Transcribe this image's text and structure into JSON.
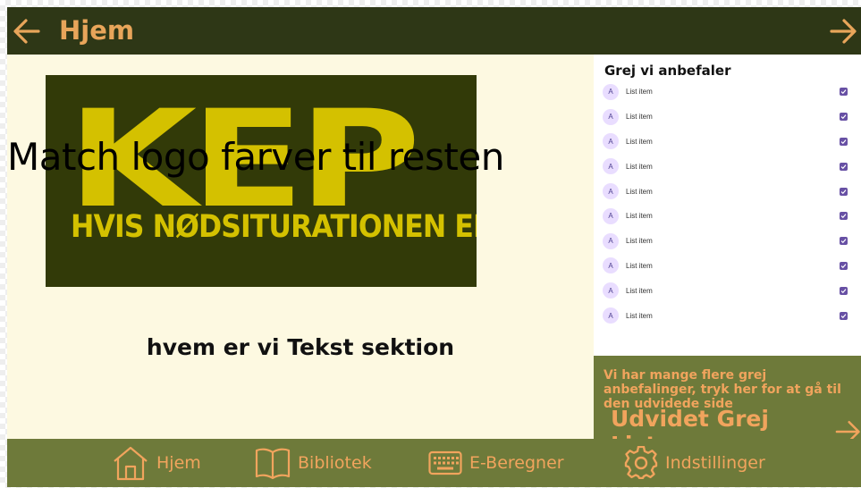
{
  "header": {
    "title": "Hjem"
  },
  "logo": {
    "big_text": "KEP",
    "tagline": "HVIS NØDSITURATIONEN ER."
  },
  "overlay_note": "Match logo farver til resten",
  "about_section": "hvem er vi Tekst sektion",
  "recommendations": {
    "heading": "Grej vi anbefaler",
    "items": [
      {
        "avatar": "A",
        "label": "List item",
        "checked": true
      },
      {
        "avatar": "A",
        "label": "List item",
        "checked": true
      },
      {
        "avatar": "A",
        "label": "List item",
        "checked": true
      },
      {
        "avatar": "A",
        "label": "List item",
        "checked": true
      },
      {
        "avatar": "A",
        "label": "List item",
        "checked": true
      },
      {
        "avatar": "A",
        "label": "List item",
        "checked": true
      },
      {
        "avatar": "A",
        "label": "List item",
        "checked": true
      },
      {
        "avatar": "A",
        "label": "List item",
        "checked": true
      },
      {
        "avatar": "A",
        "label": "List item",
        "checked": true
      },
      {
        "avatar": "A",
        "label": "List item",
        "checked": true
      }
    ]
  },
  "promo": {
    "text": "Vi har mange flere grej anbefalinger, tryk her for at gå til den udvidede side",
    "link_label": "Udvidet Grej Liste"
  },
  "bottom_nav": [
    {
      "label": "Hjem",
      "icon": "home-icon"
    },
    {
      "label": "Bibliotek",
      "icon": "book-icon"
    },
    {
      "label": "E-Beregner",
      "icon": "keyboard-icon"
    },
    {
      "label": "Indstillinger",
      "icon": "gear-icon"
    }
  ],
  "colors": {
    "topbar": "#2e3716",
    "accent": "#e8a55a",
    "content_bg": "#fdf9e1",
    "olive": "#6e7a3a",
    "logo_bg": "#323a08",
    "logo_text": "#d4c100",
    "checkbox": "#6750a4"
  }
}
